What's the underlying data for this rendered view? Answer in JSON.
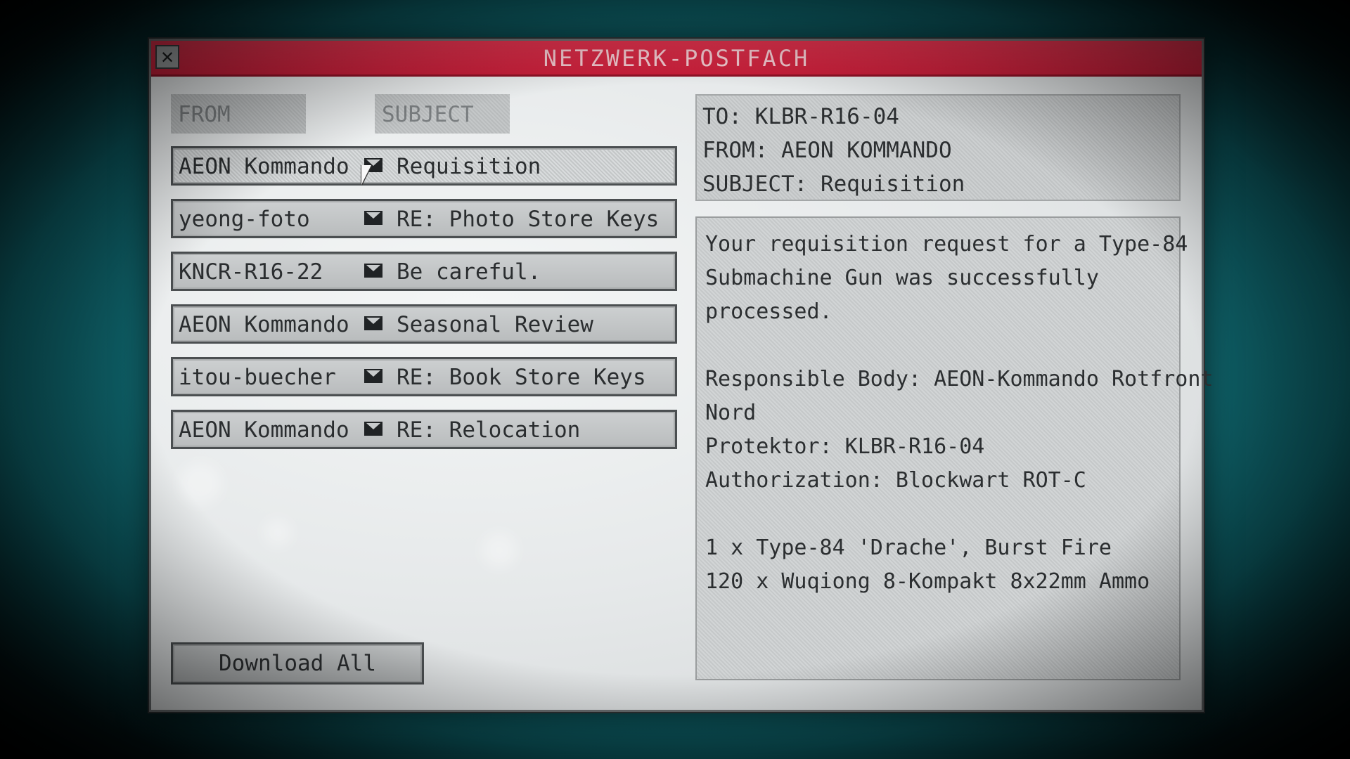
{
  "window": {
    "title": "NETZWERK-POSTFACH",
    "close_glyph": "✕"
  },
  "columns": {
    "from": "FROM",
    "subject": "SUBJECT"
  },
  "messages": [
    {
      "from": "AEON Kommando",
      "subject": "Requisition",
      "selected": true
    },
    {
      "from": "yeong-foto",
      "subject": "RE: Photo Store Keys",
      "selected": false
    },
    {
      "from": "KNCR-R16-22",
      "subject": "Be careful.",
      "selected": false
    },
    {
      "from": "AEON Kommando",
      "subject": "Seasonal Review",
      "selected": false
    },
    {
      "from": "itou-buecher",
      "subject": "RE: Book Store Keys",
      "selected": false
    },
    {
      "from": "AEON Kommando",
      "subject": "RE: Relocation",
      "selected": false
    }
  ],
  "download_button": "Download All",
  "reader": {
    "to": "TO: KLBR-R16-04",
    "from": "FROM: AEON KOMMANDO",
    "subject": "SUBJECT: Requisition",
    "body": {
      "l1": "Your requisition request for a Type-84",
      "l2": "Submachine Gun was successfully",
      "l3": "processed.",
      "l4": "Responsible Body: AEON-Kommando Rotfront",
      "l5": "Nord",
      "l6": "Protektor: KLBR-R16-04",
      "l7": "Authorization: Blockwart ROT-C",
      "l8": "1 x Type-84 'Drache', Burst Fire",
      "l9": "120 x Wuqiong 8-Kompakt 8x22mm Ammo"
    }
  },
  "colors": {
    "titlebar": "#d3284a",
    "background": "#137078",
    "panel": "#e6e9ea"
  },
  "icons": {
    "close": "close-icon",
    "mail": "mail-icon",
    "cursor": "mouse-cursor-icon"
  }
}
